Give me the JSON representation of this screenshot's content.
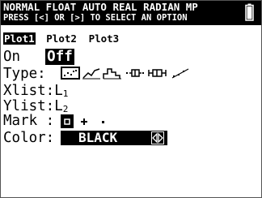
{
  "status_bar": {
    "line1": "NORMAL FLOAT AUTO REAL RADIAN MP",
    "line2": "PRESS [<] OR [>] TO SELECT AN OPTION"
  },
  "plot_tabs": [
    {
      "label": "Plot1",
      "selected": true
    },
    {
      "label": "Plot2",
      "selected": false
    },
    {
      "label": "Plot3",
      "selected": false
    }
  ],
  "on_off": {
    "on_label": "On",
    "off_label": "Off",
    "selected": "Off"
  },
  "type": {
    "label": "Type:",
    "options": [
      "scatter-plot-icon",
      "xyline-plot-icon",
      "histogram-icon",
      "modified-boxplot-icon",
      "boxplot-icon",
      "normal-probability-plot-icon"
    ],
    "selected": "scatter-plot-icon"
  },
  "xlist": {
    "label": "Xlist:",
    "value": "L",
    "sub": "1"
  },
  "ylist": {
    "label": "Ylist:",
    "value": "L",
    "sub": "2"
  },
  "mark": {
    "label": "Mark :",
    "options": [
      "square-mark-icon",
      "plus-mark-icon",
      "dot-mark-icon"
    ],
    "selected": "square-mark-icon"
  },
  "color": {
    "label": "Color:",
    "value": "BLACK",
    "color_hex": "#000000"
  }
}
